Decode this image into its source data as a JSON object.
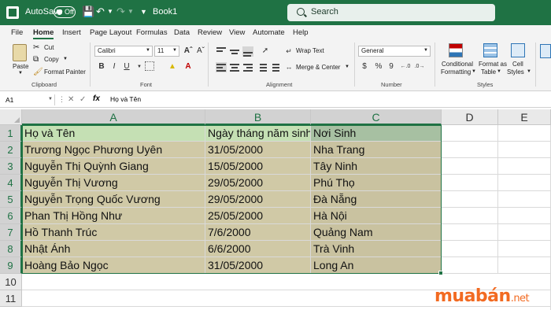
{
  "titlebar": {
    "autosave_label": "AutoSave",
    "autosave_state": "Off",
    "book_title": "Book1",
    "search_placeholder": "Search"
  },
  "menu": [
    "File",
    "Home",
    "Insert",
    "Page Layout",
    "Formulas",
    "Data",
    "Review",
    "View",
    "Automate",
    "Help"
  ],
  "ribbon": {
    "clipboard": {
      "paste": "Paste",
      "cut": "Cut",
      "copy": "Copy",
      "format_painter": "Format Painter",
      "label": "Clipboard"
    },
    "font": {
      "name": "Calibri",
      "size": "11",
      "bold": "B",
      "italic": "I",
      "underline": "U",
      "label": "Font"
    },
    "alignment": {
      "wrap_text": "Wrap Text",
      "merge_center": "Merge & Center",
      "label": "Alignment"
    },
    "number": {
      "format": "General",
      "currency": "$",
      "percent": "%",
      "comma": "9",
      "label": "Number"
    },
    "styles": {
      "conditional": "Conditional",
      "conditional2": "Formatting",
      "format_as": "Format as",
      "table": "Table",
      "cell": "Cell",
      "cell2": "Styles",
      "label": "Styles"
    }
  },
  "formula_bar": {
    "name_box": "A1",
    "fx": "fx",
    "content": "Họ và Tên"
  },
  "columns": [
    "A",
    "B",
    "C",
    "D",
    "E"
  ],
  "rows": [
    "1",
    "2",
    "3",
    "4",
    "5",
    "6",
    "7",
    "8",
    "9",
    "10",
    "11"
  ],
  "table": [
    [
      "Họ và Tên",
      "Ngày tháng năm sinh",
      "Nơi Sinh"
    ],
    [
      "Trương Ngọc Phương Uyên",
      "31/05/2000",
      "Nha Trang"
    ],
    [
      "Nguyễn Thị Quỳnh Giang",
      "15/05/2000",
      "Tây Ninh"
    ],
    [
      "Nguyễn Thị Vương",
      "29/05/2000",
      "Phú Thọ"
    ],
    [
      "Nguyễn Trọng Quốc Vương",
      "29/05/2000",
      "Đà Nẵng"
    ],
    [
      "Phan Thị Hồng Như",
      "25/05/2000",
      "Hà Nội"
    ],
    [
      "Hồ Thanh Trúc",
      "7/6/2000",
      "Quảng Nam"
    ],
    [
      "Nhật Ánh",
      "6/6/2000",
      "Trà Vinh"
    ],
    [
      "Hoàng Bảo Ngọc",
      "31/05/2000",
      "Long An"
    ]
  ],
  "watermark": {
    "brand": "muabán",
    "suffix": ".net"
  },
  "colors": {
    "accent": "#1f7244",
    "header_fill": "#c5e0b4",
    "body_fill": "#d0c9a6",
    "watermark": "#f26a21"
  }
}
